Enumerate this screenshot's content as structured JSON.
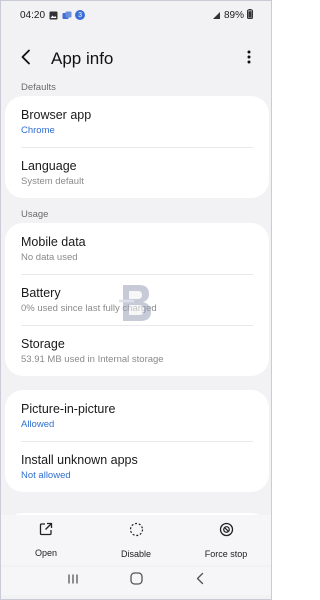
{
  "status_bar": {
    "time": "04:20",
    "notification_badge": "3",
    "battery": "89%"
  },
  "header": {
    "title": "App info"
  },
  "sections": {
    "defaults": {
      "label": "Defaults",
      "items": [
        {
          "title": "Browser app",
          "subtitle": "Chrome",
          "subtitle_style": "accent"
        },
        {
          "title": "Language",
          "subtitle": "System default",
          "subtitle_style": "muted"
        }
      ]
    },
    "usage": {
      "label": "Usage",
      "items": [
        {
          "title": "Mobile data",
          "subtitle": "No data used",
          "subtitle_style": "muted"
        },
        {
          "title": "Battery",
          "subtitle": "0% used since last fully charged",
          "subtitle_style": "muted"
        },
        {
          "title": "Storage",
          "subtitle": "53.91 MB used in Internal storage",
          "subtitle_style": "muted"
        }
      ]
    },
    "advanced": {
      "items": [
        {
          "title": "Picture-in-picture",
          "subtitle": "Allowed",
          "subtitle_style": "accent"
        },
        {
          "title": "Install unknown apps",
          "subtitle": "Not allowed",
          "subtitle_style": "accent"
        }
      ]
    }
  },
  "actions": {
    "open": "Open",
    "disable": "Disable",
    "force_stop": "Force stop"
  },
  "icons": {
    "back": "back-arrow-icon",
    "more": "more-vertical-icon",
    "open": "open-external-icon",
    "disable": "disable-dashed-circle-icon",
    "force_stop": "force-stop-icon",
    "recents": "recents-icon",
    "home": "home-icon",
    "nav_back": "nav-back-icon"
  },
  "colors": {
    "accent": "#2f6fcf",
    "background": "#f2f2f4",
    "card": "#ffffff"
  }
}
